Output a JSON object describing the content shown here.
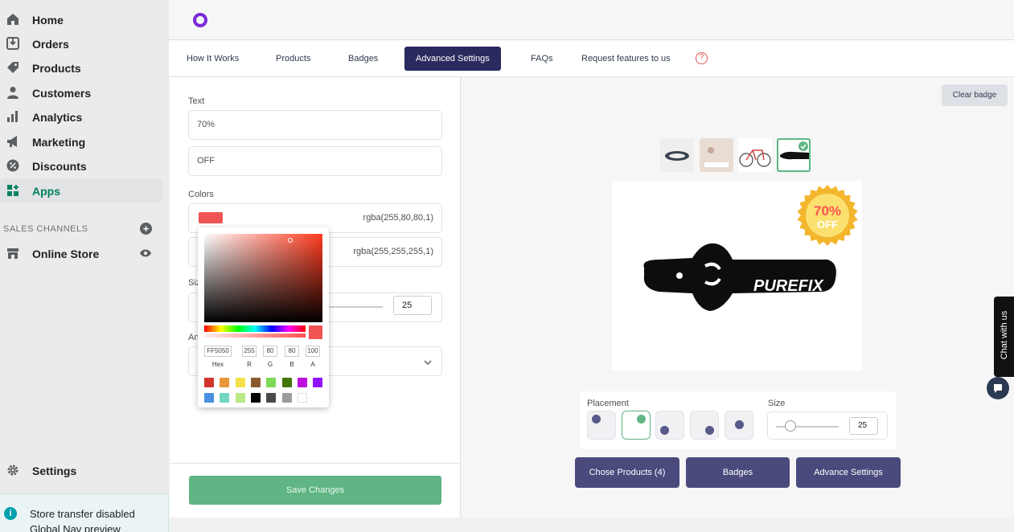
{
  "sidebar": {
    "items": [
      {
        "label": "Home",
        "icon": "home-icon"
      },
      {
        "label": "Orders",
        "icon": "orders-icon"
      },
      {
        "label": "Products",
        "icon": "tag-icon"
      },
      {
        "label": "Customers",
        "icon": "person-icon"
      },
      {
        "label": "Analytics",
        "icon": "bar-chart-icon"
      },
      {
        "label": "Marketing",
        "icon": "megaphone-icon"
      },
      {
        "label": "Discounts",
        "icon": "discount-icon"
      },
      {
        "label": "Apps",
        "icon": "apps-icon"
      }
    ],
    "sales_channels_title": "SALES CHANNELS",
    "online_store": "Online Store",
    "settings": "Settings",
    "notice_line1": "Store transfer disabled",
    "notice_line2": "Global Nav preview"
  },
  "tabs": [
    {
      "label": "How It Works"
    },
    {
      "label": "Products"
    },
    {
      "label": "Badges"
    },
    {
      "label": "Advanced Settings"
    },
    {
      "label": "FAQs"
    },
    {
      "label": "Request features to us"
    }
  ],
  "help_icon_glyph": "?",
  "form": {
    "text_label": "Text",
    "text_line1": "70%",
    "text_line2": "OFF",
    "colors_label": "Colors",
    "color1_value": "rgba(255,80,80,1)",
    "color2_value": "rgba(255,255,255,1)",
    "color1_hex": "#f05454",
    "size_label_partial": "Siz",
    "size_value": "25",
    "anim_label_partial": "An",
    "save_label": "Save Changes"
  },
  "picker": {
    "hex": "FF5050",
    "r": "255",
    "g": "80",
    "b": "80",
    "a": "100",
    "labels": {
      "hex": "Hex",
      "r": "R",
      "g": "G",
      "b": "B",
      "a": "A"
    },
    "presets": [
      "#d0342c",
      "#e8963a",
      "#f5e04a",
      "#8b5a2b",
      "#7ed957",
      "#417505",
      "#bd10e0",
      "#9013fe",
      "#4a90e2",
      "#70d6c0",
      "#b8e986",
      "#000000",
      "#4a4a4a",
      "#9b9b9b",
      "#ffffff"
    ]
  },
  "preview": {
    "clear_badge": "Clear badge",
    "badge_line1": "70%",
    "badge_line2": "OFF",
    "product_text": "PUREFIX",
    "placement_label": "Placement",
    "size_label": "Size",
    "size_value": "25",
    "buttons": [
      "Chose Products (4)",
      "Badges",
      "Advance Settings"
    ]
  },
  "chat": {
    "label": "Chat with us"
  }
}
